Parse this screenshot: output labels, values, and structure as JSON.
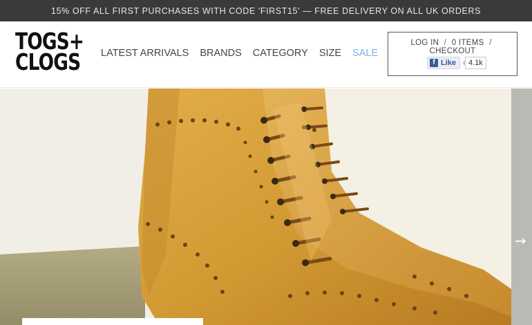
{
  "promo_bar": {
    "text": "15% OFF ALL FIRST PURCHASES WITH CODE 'FIRST15' — FREE DELIVERY ON ALL UK ORDERS"
  },
  "logo": {
    "line1": "TOGS+",
    "line2": "CLOGS"
  },
  "nav": {
    "items": [
      {
        "label": "LATEST ARRIVALS"
      },
      {
        "label": "BRANDS"
      },
      {
        "label": "CATEGORY"
      },
      {
        "label": "SIZE"
      },
      {
        "label": "SALE"
      }
    ]
  },
  "account": {
    "login": "LOG IN",
    "items": "0 ITEMS",
    "checkout": "CHECKOUT",
    "separator": "/",
    "fb_like": "Like",
    "fb_icon": "f",
    "fb_count": "4.1k"
  },
  "hero": {
    "next_icon": "→"
  },
  "colors": {
    "promo_bg": "#3a3a3a",
    "sale": "#7fb2e6",
    "facebook": "#3b5998",
    "boot_tan": "#d9a43a"
  }
}
